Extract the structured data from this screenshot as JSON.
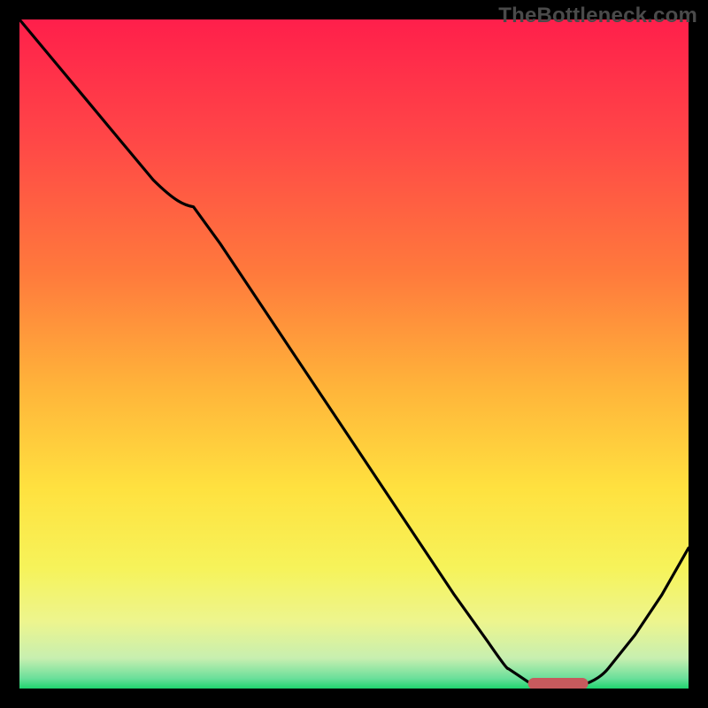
{
  "watermark": "TheBottleneck.com",
  "colors": {
    "frame": "#000000",
    "watermark_text": "#4a4a4a",
    "curve": "#000000",
    "marker": "#c75a5d",
    "gradient_stops": [
      {
        "offset": 0.0,
        "color": "#ff1f4b"
      },
      {
        "offset": 0.18,
        "color": "#ff4747"
      },
      {
        "offset": 0.38,
        "color": "#ff7a3c"
      },
      {
        "offset": 0.55,
        "color": "#ffb43a"
      },
      {
        "offset": 0.7,
        "color": "#ffe13f"
      },
      {
        "offset": 0.82,
        "color": "#f6f35a"
      },
      {
        "offset": 0.9,
        "color": "#edf58e"
      },
      {
        "offset": 0.955,
        "color": "#c7efb0"
      },
      {
        "offset": 0.985,
        "color": "#6adf9a"
      },
      {
        "offset": 1.0,
        "color": "#1fd56f"
      }
    ]
  },
  "chart_data": {
    "type": "line",
    "title": "",
    "xlabel": "",
    "ylabel": "",
    "xlim": [
      0,
      100
    ],
    "ylim": [
      0,
      100
    ],
    "grid": false,
    "legend": false,
    "series": [
      {
        "name": "bottleneck-curve",
        "x": [
          0,
          5,
          10,
          15,
          20,
          26,
          30,
          35,
          40,
          45,
          50,
          55,
          60,
          65,
          70,
          73,
          76,
          80,
          84,
          88,
          92,
          96,
          100
        ],
        "y": [
          100,
          94,
          88,
          82,
          76,
          72,
          66.5,
          59,
          51.5,
          44,
          36.5,
          29,
          21.5,
          14,
          7,
          3,
          1,
          0.5,
          0.5,
          3,
          8,
          14,
          21
        ]
      }
    ],
    "annotations": [
      {
        "name": "optimal-marker",
        "shape": "rounded-bar",
        "x_range": [
          76,
          85
        ],
        "y": 0.8,
        "color": "#c75a5d"
      }
    ],
    "background": "vertical-gradient (red→orange→yellow→green) with green at bottom"
  }
}
